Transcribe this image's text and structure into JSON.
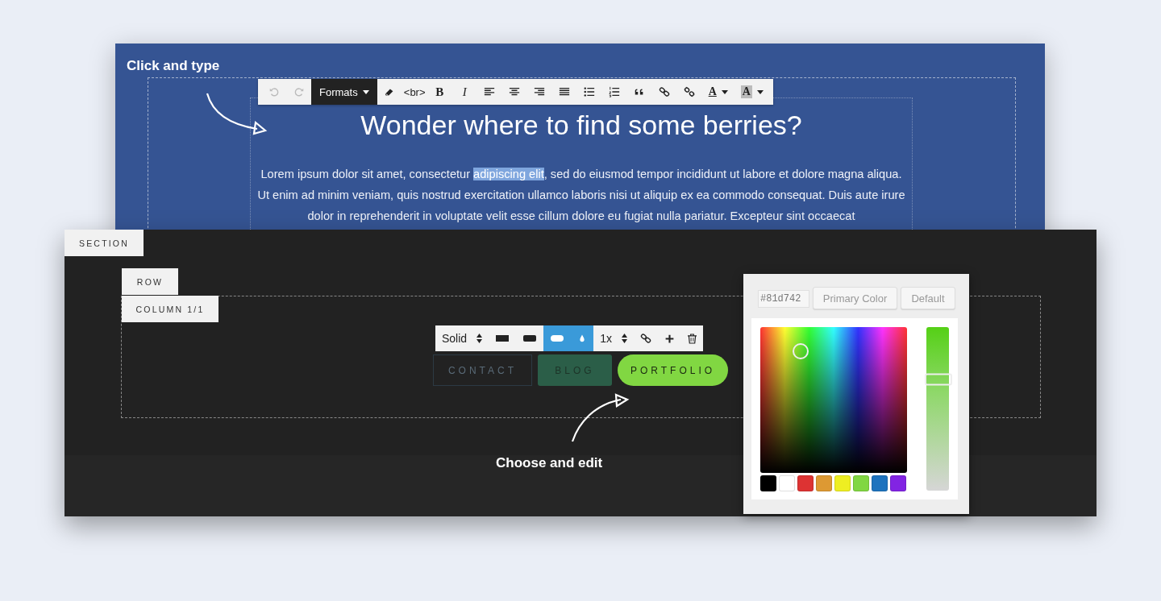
{
  "editor": {
    "hint": "Click and type",
    "toolbar": [
      {
        "kind": "undo",
        "disabled": true
      },
      {
        "kind": "redo",
        "disabled": true
      },
      {
        "kind": "menu",
        "label": "Formats",
        "disabled": false
      },
      {
        "kind": "eraser",
        "disabled": false
      },
      {
        "kind": "text",
        "label": "<br>",
        "disabled": false
      },
      {
        "kind": "bold",
        "label": "B",
        "disabled": false
      },
      {
        "kind": "italic",
        "label": "I",
        "disabled": false
      },
      {
        "kind": "alignleft",
        "disabled": false
      },
      {
        "kind": "aligncenter",
        "disabled": false
      },
      {
        "kind": "alignright",
        "disabled": false
      },
      {
        "kind": "justify",
        "disabled": false
      },
      {
        "kind": "bullets",
        "disabled": false
      },
      {
        "kind": "numbers",
        "disabled": false
      },
      {
        "kind": "quote",
        "disabled": false
      },
      {
        "kind": "link",
        "disabled": false
      },
      {
        "kind": "unlink",
        "disabled": false
      },
      {
        "kind": "color",
        "label": "A",
        "disabled": false
      },
      {
        "kind": "highlight",
        "label": "A",
        "disabled": false
      }
    ],
    "heading": "Wonder where to find some berries?",
    "paragraph": {
      "before": "Lorem ipsum dolor sit amet, consectetur ",
      "selection": "adipiscing elit",
      "after": ", sed do eiusmod tempor incididunt ut labore et dolore magna aliqua. Ut enim ad minim veniam, quis nostrud exercitation ullamco laboris nisi ut aliquip ex ea commodo consequat. Duis aute irure dolor in reprehenderit in voluptate velit esse cillum dolore eu fugiat nulla pariatur. Excepteur sint occaecat"
    }
  },
  "builder": {
    "tags": [
      "SECTION",
      "ROW",
      "COLUMN 1/1"
    ],
    "button_toolbar": [
      {
        "kind": "select",
        "label": "Solid",
        "selected": false
      },
      {
        "kind": "square",
        "selected": false
      },
      {
        "kind": "rounded",
        "selected": false
      },
      {
        "kind": "pill",
        "selected": true
      },
      {
        "kind": "drop",
        "selected": true
      },
      {
        "kind": "select",
        "label": "1x",
        "selected": false
      },
      {
        "kind": "link",
        "selected": false
      },
      {
        "kind": "plus",
        "selected": false
      },
      {
        "kind": "trash",
        "selected": false
      }
    ],
    "buttons": [
      {
        "kind": "outline",
        "label": "CONTACT"
      },
      {
        "kind": "square",
        "label": "BLOG"
      },
      {
        "kind": "pill",
        "label": "PORTFOLIO"
      }
    ],
    "hint": "Choose and edit"
  },
  "color_picker": {
    "hex": "#81d742",
    "buttons": [
      "Primary Color",
      "Default"
    ],
    "swatches": [
      {
        "color": "#000000"
      },
      {
        "color": "#ffffff"
      },
      {
        "color": "#dd3333"
      },
      {
        "color": "#dd9933"
      },
      {
        "color": "#eeee22"
      },
      {
        "color": "#81d742"
      },
      {
        "color": "#1e73be"
      },
      {
        "color": "#8224e3"
      }
    ],
    "lightness": {
      "level": 0.68
    }
  }
}
